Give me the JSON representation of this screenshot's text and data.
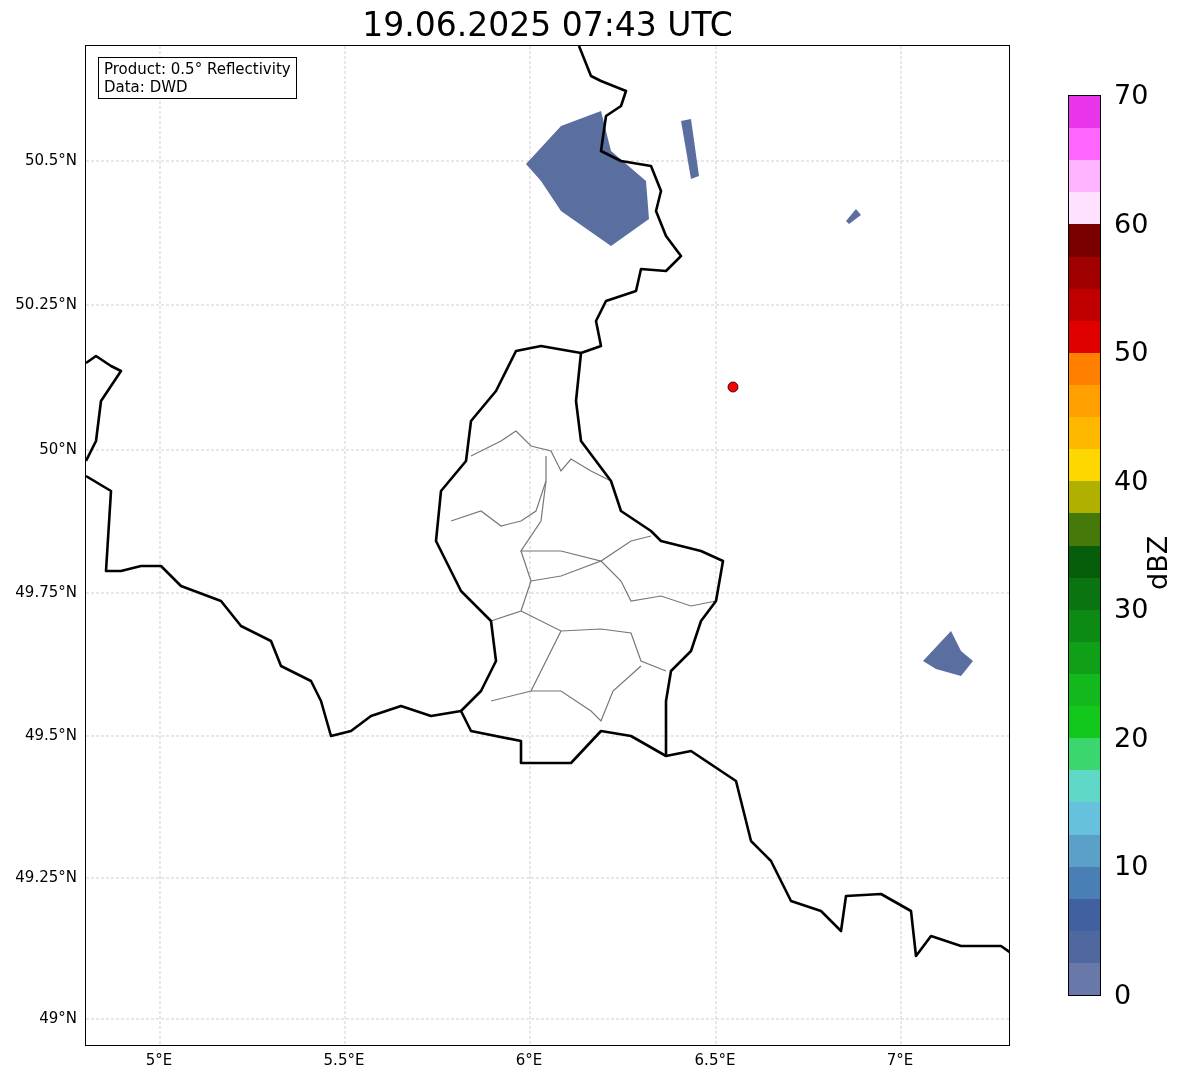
{
  "title": "19.06.2025 07:43 UTC",
  "legend": [
    "Product: 0.5° Reflectivity",
    "Data: DWD"
  ],
  "map": {
    "yticks": [
      "50.5°N",
      "50.25°N",
      "50°N",
      "49.75°N",
      "49.5°N",
      "49.25°N",
      "49°N"
    ],
    "xticks": [
      "5°E",
      "5.5°E",
      "6°E",
      "6.5°E",
      "7°E"
    ]
  },
  "colorbar": {
    "label": "dBZ",
    "ticks": [
      "70",
      "60",
      "50",
      "40",
      "30",
      "20",
      "10",
      "0"
    ],
    "segments": [
      {
        "color": "#e935e9"
      },
      {
        "color": "#ff66ff"
      },
      {
        "color": "#ffb3ff"
      },
      {
        "color": "#ffe0ff"
      },
      {
        "color": "#7a0000"
      },
      {
        "color": "#a00000"
      },
      {
        "color": "#c00000"
      },
      {
        "color": "#e00000"
      },
      {
        "color": "#ff7f00"
      },
      {
        "color": "#ff9f00"
      },
      {
        "color": "#ffb800"
      },
      {
        "color": "#ffd700"
      },
      {
        "color": "#b0b000"
      },
      {
        "color": "#457a0a"
      },
      {
        "color": "#075e0a"
      },
      {
        "color": "#0a7510"
      },
      {
        "color": "#0d8a14"
      },
      {
        "color": "#10a018"
      },
      {
        "color": "#12b81c"
      },
      {
        "color": "#12c81c"
      },
      {
        "color": "#3cd66e"
      },
      {
        "color": "#60d8c8"
      },
      {
        "color": "#66c2dc"
      },
      {
        "color": "#5aa0c8"
      },
      {
        "color": "#4a7fb5"
      },
      {
        "color": "#4060a0"
      },
      {
        "color": "#5068a0"
      },
      {
        "color": "#6878a8"
      }
    ]
  }
}
